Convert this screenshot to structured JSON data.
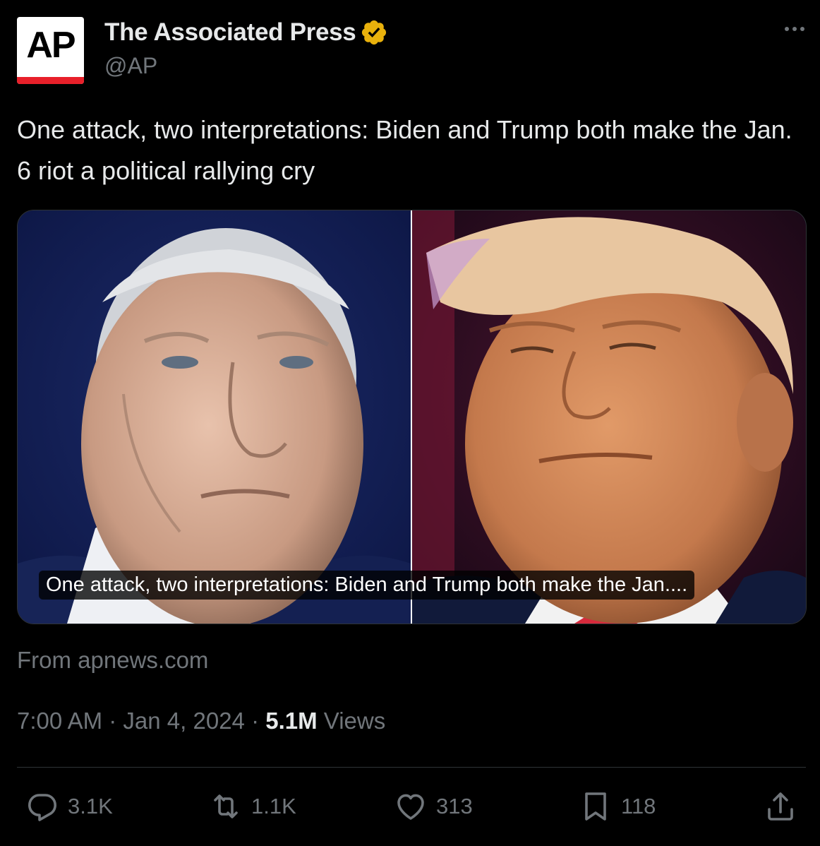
{
  "account": {
    "display_name": "The Associated Press",
    "handle": "@AP",
    "avatar_logo": "AP",
    "verified_icon": "gold-verified-badge-icon"
  },
  "tweet": {
    "text": "One attack, two interpretations: Biden and Trump both make the Jan. 6 riot a political rallying cry"
  },
  "card": {
    "caption": "One attack, two interpretations: Biden and Trump both make the Jan...."
  },
  "source": {
    "label": "From apnews.com"
  },
  "meta": {
    "time": "7:00 AM",
    "date": "Jan 4, 2024",
    "separator": "·",
    "views_count": "5.1M",
    "views_label": "Views"
  },
  "actions": {
    "replies": "3.1K",
    "reposts": "1.1K",
    "likes": "313",
    "bookmarks": "118"
  },
  "colors": {
    "background": "#000000",
    "text_primary": "#e7e9ea",
    "text_secondary": "#71767b",
    "border": "#2f3336",
    "verified_gold": "#e9b10c",
    "ap_red": "#e8202a"
  }
}
